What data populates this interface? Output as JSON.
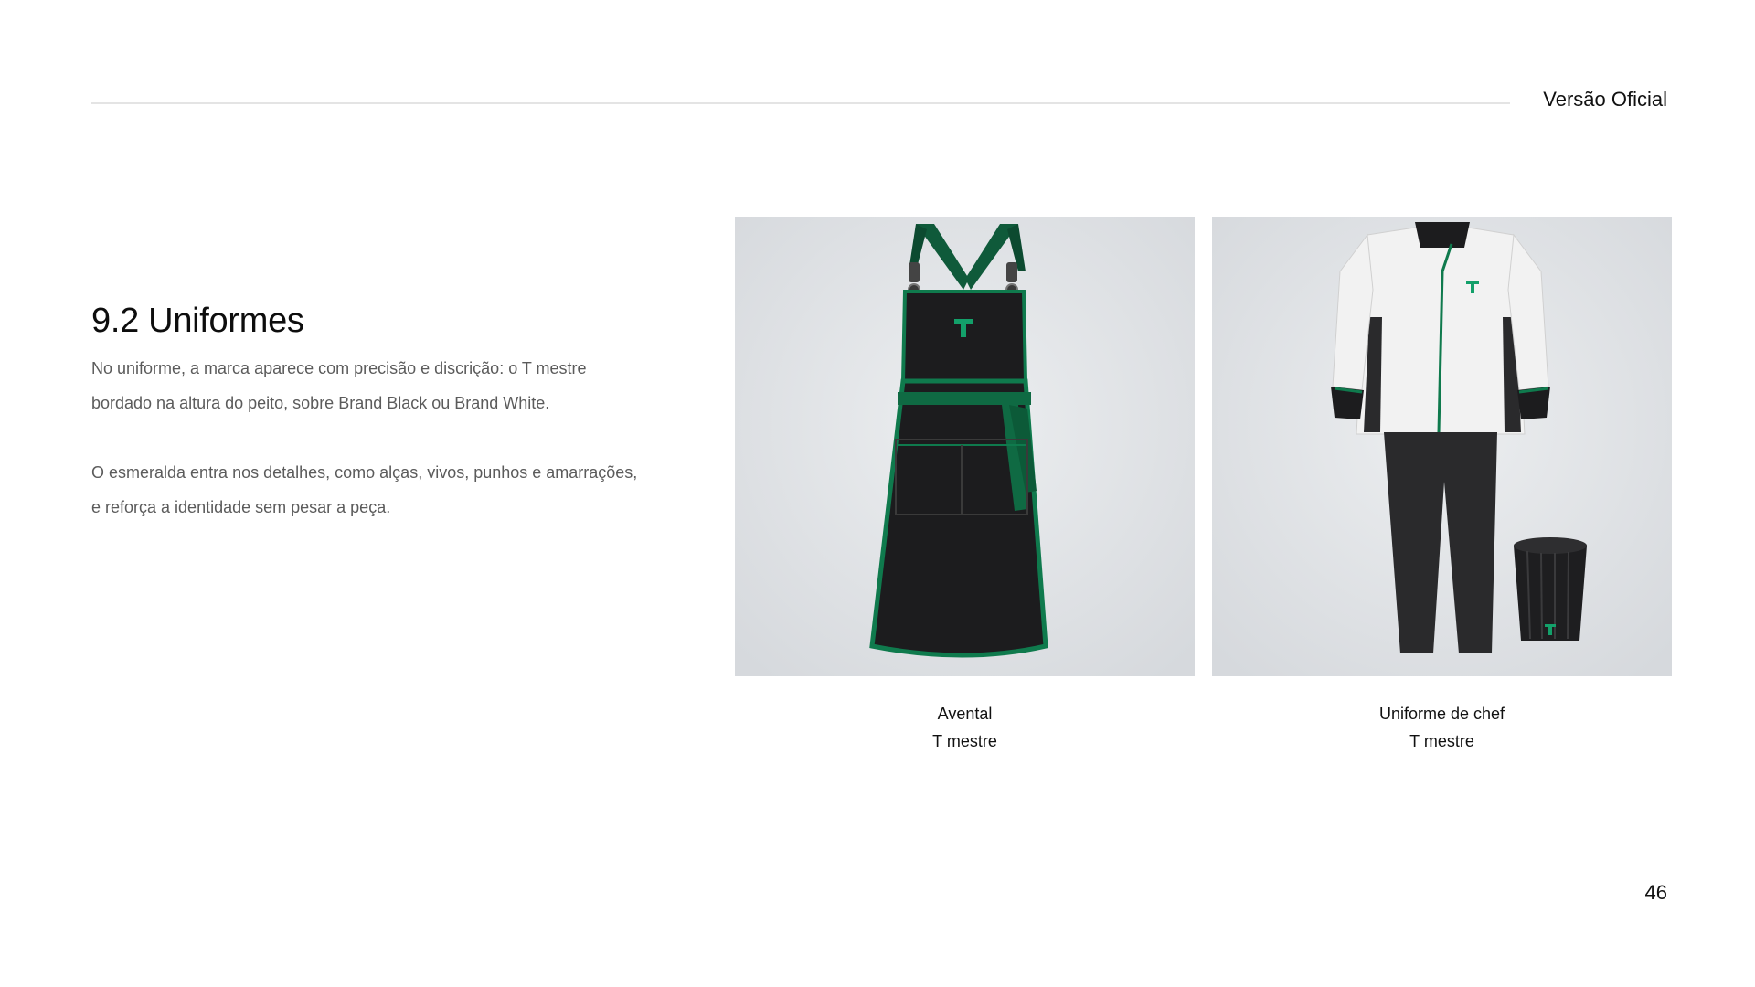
{
  "header": {
    "version_label": "Versão Oficial"
  },
  "section": {
    "title": "9.2 Uniformes",
    "paragraphs": [
      "No uniforme, a marca aparece com precisão e discrição: o T mestre bordado na altura do peito, sobre Brand Black ou Brand White.",
      "O esmeralda entra nos detalhes, como alças, vivos, punhos e amarrações, e reforça a identidade sem pesar a peça."
    ]
  },
  "gallery": [
    {
      "image": "apron-illustration",
      "caption_line1": "Avental",
      "caption_line2": "T mestre"
    },
    {
      "image": "chef-uniform-illustration",
      "caption_line1": "Uniforme de chef",
      "caption_line2": "T mestre"
    }
  ],
  "footer": {
    "page_number": "46"
  },
  "colors": {
    "brand_black": "#1c1c1e",
    "brand_emerald": "#0f7a4d",
    "brand_white": "#f4f4f4",
    "photo_background": "#dfe1e4"
  }
}
